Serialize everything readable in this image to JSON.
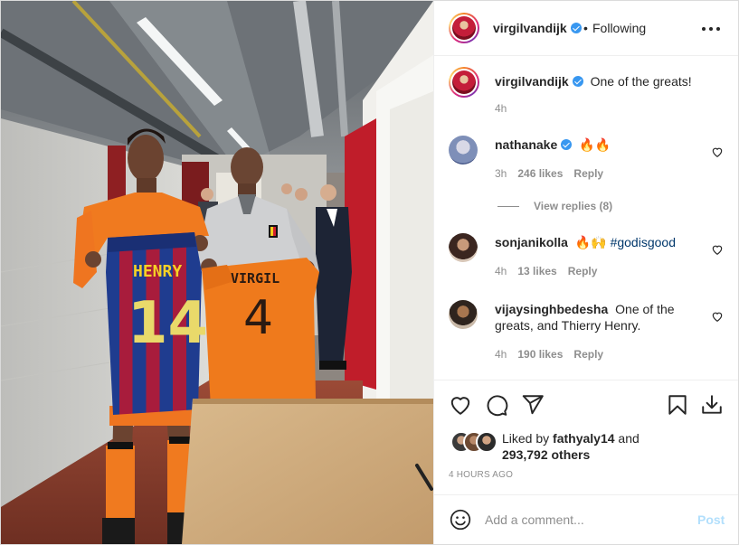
{
  "post": {
    "author": "virgilvandijk",
    "follow_separator": "•",
    "follow_status": "Following"
  },
  "caption": {
    "author": "virgilvandijk",
    "text": "One of the greats!",
    "time": "4h"
  },
  "comments": [
    {
      "username": "nathanake",
      "verified": true,
      "text": "🔥🔥",
      "time": "3h",
      "likes": "246 likes",
      "reply": "Reply",
      "view_replies": "View replies (8)"
    },
    {
      "username": "sonjanikolla",
      "verified": false,
      "text": "🔥🙌",
      "hashtag": "#godisgood",
      "time": "4h",
      "likes": "13 likes",
      "reply": "Reply"
    },
    {
      "username": "vijaysinghbedesha",
      "verified": false,
      "text": "One of the greats, and Thierry Henry.",
      "time": "4h",
      "likes": "190 likes",
      "reply": "Reply"
    }
  ],
  "actions": {
    "icons": [
      "heart-icon",
      "comment-icon",
      "share-icon",
      "bookmark-icon",
      "download-icon"
    ]
  },
  "likes": {
    "prefix": "Liked by",
    "user": "fathyaly14",
    "and": "and",
    "others": "293,792 others"
  },
  "timestamp": "4 HOURS AGO",
  "add_comment": {
    "placeholder": "Add a comment...",
    "post_label": "Post"
  },
  "photo": {
    "shirt_left_name": "HENRY",
    "shirt_left_number": "14",
    "shirt_right_name": "VIRGIL",
    "shirt_right_number": "4"
  },
  "colors": {
    "verified": "#3897f0",
    "post_disabled": "#b2dffc",
    "hashtag": "#00376b",
    "muted": "#8e8e8e"
  }
}
